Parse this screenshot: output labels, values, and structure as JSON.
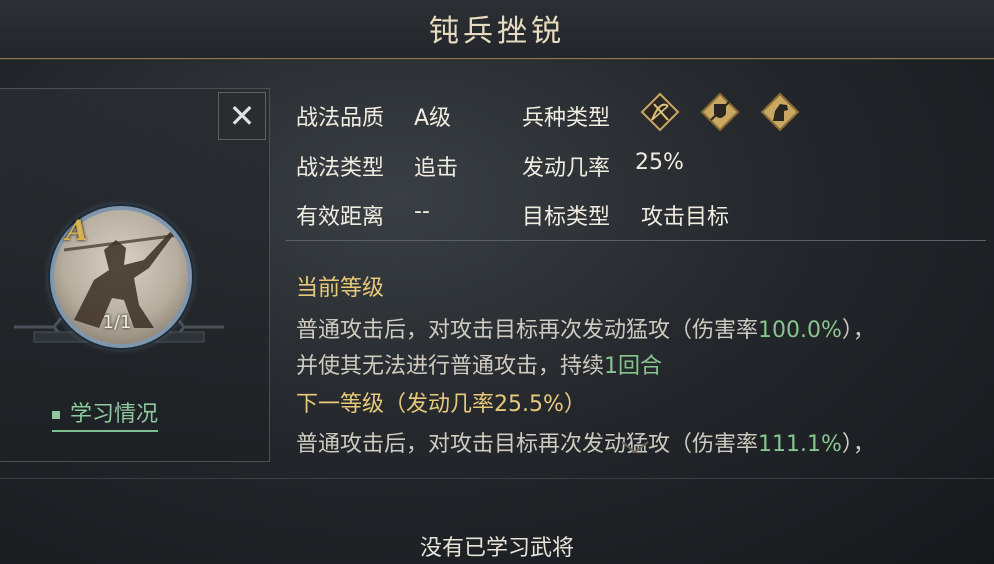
{
  "title": "钝兵挫锐",
  "close_label": "✕",
  "skill": {
    "grade_badge": "A",
    "level": "1/1",
    "learn_link": "学习情况"
  },
  "attributes": {
    "quality_label": "战法品质",
    "quality_value": "A级",
    "troop_label": "兵种类型",
    "troop_icons": [
      "bow-cavalry-icon",
      "shield-infantry-icon",
      "horse-cavalry-icon"
    ],
    "type_label": "战法类型",
    "type_value": "追击",
    "rate_label": "发动几率",
    "rate_value": "25%",
    "range_label": "有效距离",
    "range_value": "--",
    "target_label": "目标类型",
    "target_value": "攻击目标"
  },
  "current_level": {
    "heading": "当前等级",
    "line1_a": "普通攻击后，对攻击目标再次发动猛攻（伤害率",
    "line1_b": "100.0%",
    "line1_c": "），",
    "line2_a": "并使其无法进行普通攻击，持续",
    "line2_b": "1回合"
  },
  "next_level": {
    "heading": "下一等级（发动几率25.5%）",
    "line1_a": "普通攻击后，对攻击目标再次发动猛攻（伤害率",
    "line1_b": "111.1%",
    "line1_c": "），"
  },
  "bottom_message": "没有已学习武将",
  "colors": {
    "gold": "#e8c97a",
    "green": "#87c58e",
    "frame": "#8a7a55"
  }
}
